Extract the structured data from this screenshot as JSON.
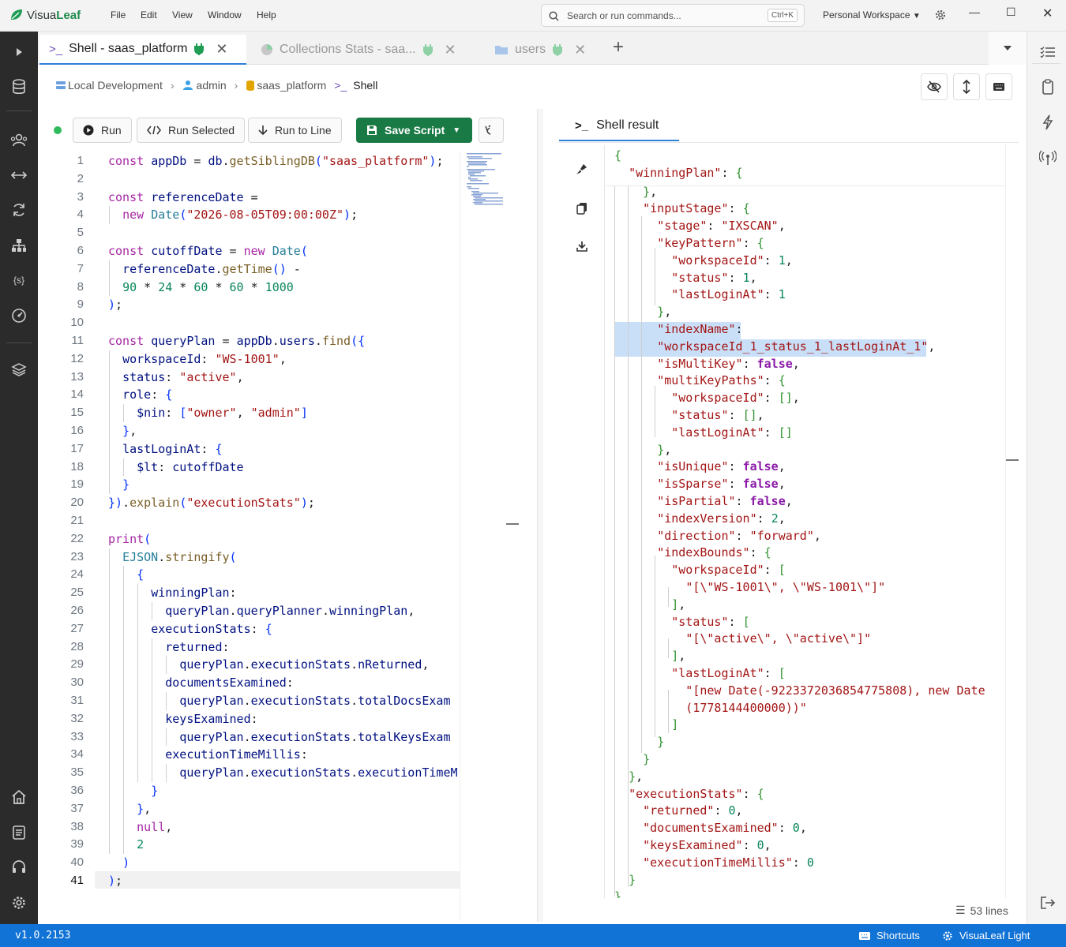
{
  "app": {
    "name_a": "Visua",
    "name_b": "Leaf",
    "version": "v1.0.2153"
  },
  "menu": [
    "File",
    "Edit",
    "View",
    "Window",
    "Help"
  ],
  "search": {
    "placeholder": "Search or run commands...",
    "shortcut": "Ctrl+K"
  },
  "workspace": {
    "label": "Personal Workspace"
  },
  "tabs": [
    {
      "label": "Shell - saas_platform",
      "active": true
    },
    {
      "label": "Collections Stats - saa...",
      "active": false
    },
    {
      "label": "users",
      "active": false
    }
  ],
  "breadcrumb": {
    "connection": "Local Development",
    "user": "admin",
    "database": "saas_platform",
    "current": "Shell"
  },
  "toolbar": {
    "run": "Run",
    "run_selected": "Run Selected",
    "run_to_line": "Run to Line",
    "save_script": "Save Script"
  },
  "editor": {
    "current_line": 41,
    "lines": [
      "const appDb = db.getSiblingDB(\"saas_platform\");",
      "",
      "const referenceDate =",
      "  new Date(\"2026-08-05T09:00:00Z\");",
      "",
      "const cutoffDate = new Date(",
      "  referenceDate.getTime() -",
      "  90 * 24 * 60 * 60 * 1000",
      ");",
      "",
      "const queryPlan = appDb.users.find({",
      "  workspaceId: \"WS-1001\",",
      "  status: \"active\",",
      "  role: {",
      "    $nin: [\"owner\", \"admin\"]",
      "  },",
      "  lastLoginAt: {",
      "    $lt: cutoffDate",
      "  }",
      "}).explain(\"executionStats\");",
      "",
      "print(",
      "  EJSON.stringify(",
      "    {",
      "      winningPlan:",
      "        queryPlan.queryPlanner.winningPlan,",
      "      executionStats: {",
      "        returned:",
      "          queryPlan.executionStats.nReturned,",
      "        documentsExamined:",
      "          queryPlan.executionStats.totalDocsExam",
      "        keysExamined:",
      "          queryPlan.executionStats.totalKeysExam",
      "        executionTimeMillis:",
      "          queryPlan.executionStats.executionTimeM",
      "      }",
      "    },",
      "    null,",
      "    2",
      "  )",
      ");"
    ]
  },
  "result": {
    "tab_label": "Shell result",
    "lines_count": "53 lines",
    "lines": [
      "{",
      "  \"winningPlan\": {",
      "    },",
      "    \"inputStage\": {",
      "      \"stage\": \"IXSCAN\",",
      "      \"keyPattern\": {",
      "        \"workspaceId\": 1,",
      "        \"status\": 1,",
      "        \"lastLoginAt\": 1",
      "      },",
      "      \"indexName\":",
      "      \"workspaceId_1_status_1_lastLoginAt_1\",",
      "      \"isMultiKey\": false,",
      "      \"multiKeyPaths\": {",
      "        \"workspaceId\": [],",
      "        \"status\": [],",
      "        \"lastLoginAt\": []",
      "      },",
      "      \"isUnique\": false,",
      "      \"isSparse\": false,",
      "      \"isPartial\": false,",
      "      \"indexVersion\": 2,",
      "      \"direction\": \"forward\",",
      "      \"indexBounds\": {",
      "        \"workspaceId\": [",
      "          \"[\\\"WS-1001\\\", \\\"WS-1001\\\"]\"",
      "        ],",
      "        \"status\": [",
      "          \"[\\\"active\\\", \\\"active\\\"]\"",
      "        ],",
      "        \"lastLoginAt\": [",
      "          \"[new Date(-9223372036854775808), new Date",
      "          (1778144400000))\"",
      "        ]",
      "      }",
      "    }",
      "  },",
      "  \"executionStats\": {",
      "    \"returned\": 0,",
      "    \"documentsExamined\": 0,",
      "    \"keysExamined\": 0,",
      "    \"executionTimeMillis\": 0",
      "  }",
      "}"
    ]
  },
  "statusbar": {
    "shortcuts": "Shortcuts",
    "theme": "VisuaLeaf Light"
  },
  "colors": {
    "accent": "#1273d6",
    "primary_button": "#1a7a45",
    "sidebar": "#2b2b2b",
    "selection": "#c9dff7"
  }
}
